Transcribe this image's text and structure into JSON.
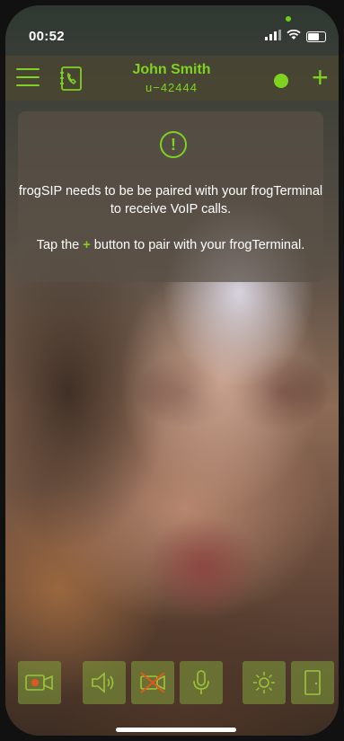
{
  "status_bar": {
    "time": "00:52"
  },
  "header": {
    "user_name": "John Smith",
    "user_id": "u−42444",
    "presence_color": "#7ed321"
  },
  "notice": {
    "icon": "exclamation-circle-icon",
    "line1": "frogSIP needs to be be paired with your frogTerminal to receive VoIP calls.",
    "line2_before": "Tap the ",
    "line2_plus": "+",
    "line2_after": " button to pair with your frogTerminal."
  },
  "toolbar": {
    "buttons": [
      {
        "icon": "video-record-icon"
      },
      {
        "icon": "speaker-icon"
      },
      {
        "icon": "video-off-icon"
      },
      {
        "icon": "microphone-icon"
      },
      {
        "icon": "brightness-icon"
      },
      {
        "icon": "door-icon"
      }
    ]
  },
  "colors": {
    "accent": "#7ed321",
    "record": "#e0581e"
  }
}
